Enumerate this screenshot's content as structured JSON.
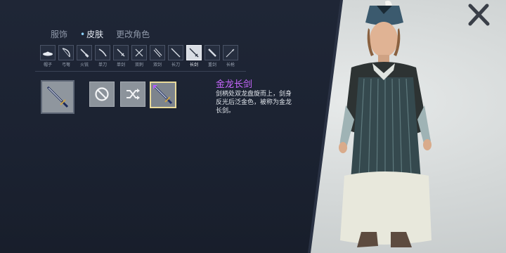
{
  "tabs": [
    {
      "label": "服饰",
      "active": false
    },
    {
      "label": "皮肤",
      "active": true
    },
    {
      "label": "更改角色",
      "active": false
    }
  ],
  "weapon_types": [
    {
      "label": "帽子",
      "icon": "hat-icon"
    },
    {
      "label": "弓弩",
      "icon": "bow-icon"
    },
    {
      "label": "火铳",
      "icon": "musket-icon"
    },
    {
      "label": "单刀",
      "icon": "saber-icon"
    },
    {
      "label": "单剑",
      "icon": "sword-icon"
    },
    {
      "label": "双刺",
      "icon": "twin-daggers-icon"
    },
    {
      "label": "双剑",
      "icon": "twin-swords-icon"
    },
    {
      "label": "长刀",
      "icon": "longblade-icon"
    },
    {
      "label": "长剑",
      "icon": "longsword-icon",
      "active": true
    },
    {
      "label": "重剑",
      "icon": "greatsword-icon"
    },
    {
      "label": "长枪",
      "icon": "spear-icon"
    }
  ],
  "item": {
    "name": "金龙长剑",
    "description": "剑柄处双龙盘旋而上，剑身反光后泛金色，被称为金龙长剑。"
  },
  "colors": {
    "panel": "#1f2636",
    "backdrop": "#d4d8d8",
    "item_name": "#c867ff",
    "selected_border": "#e8d99a",
    "active_dot": "#8fd3ff"
  }
}
